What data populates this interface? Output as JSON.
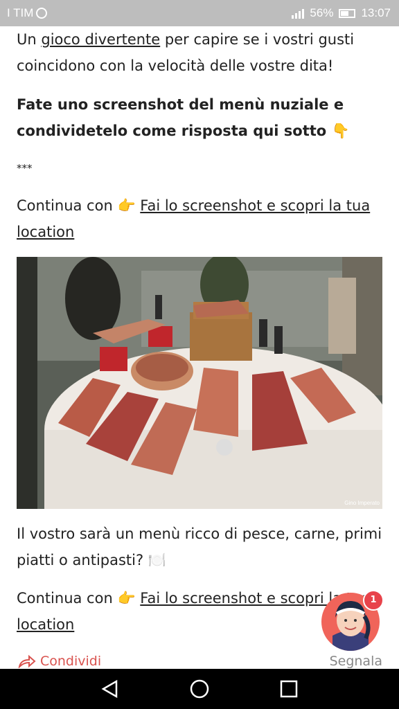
{
  "status": {
    "carrier": "I TIM",
    "battery": "56%",
    "time": "13:07"
  },
  "article": {
    "p1_prefix": "Un ",
    "p1_link": "gioco divertente",
    "p1_suffix": " per capire se i vostri gusti coincidono con la velocità delle vostre dita!",
    "p2_text": "Fate uno screenshot del menù nuziale e condividetelo come risposta qui sotto",
    "p2_emoji": "👇",
    "separator": "***",
    "continue_label": "Continua con",
    "point_emoji": "👉",
    "continue_link": "Fai lo screenshot e scopri la tua location",
    "photo_credit": "Gino Imperato",
    "p5_text": "Il vostro sarà un menù ricco di pesce, carne, primi piatti o antipasti?",
    "p5_emoji": "🍽️",
    "continue2_label": "Continua con",
    "continue2_link": "Fai lo screenshot e scopri la tua location"
  },
  "actions": {
    "share_label": "Condividi",
    "report_label": "Segnala"
  },
  "assistant": {
    "badge_count": "1"
  },
  "colors": {
    "status_bar": "#bdbdbd",
    "share": "#d9534f",
    "badge": "#e8434b",
    "avatar_bg": "#f0645a"
  },
  "icons": {
    "share": "share-icon",
    "back": "back-triangle-icon",
    "home": "home-circle-icon",
    "recents": "recents-square-icon"
  }
}
